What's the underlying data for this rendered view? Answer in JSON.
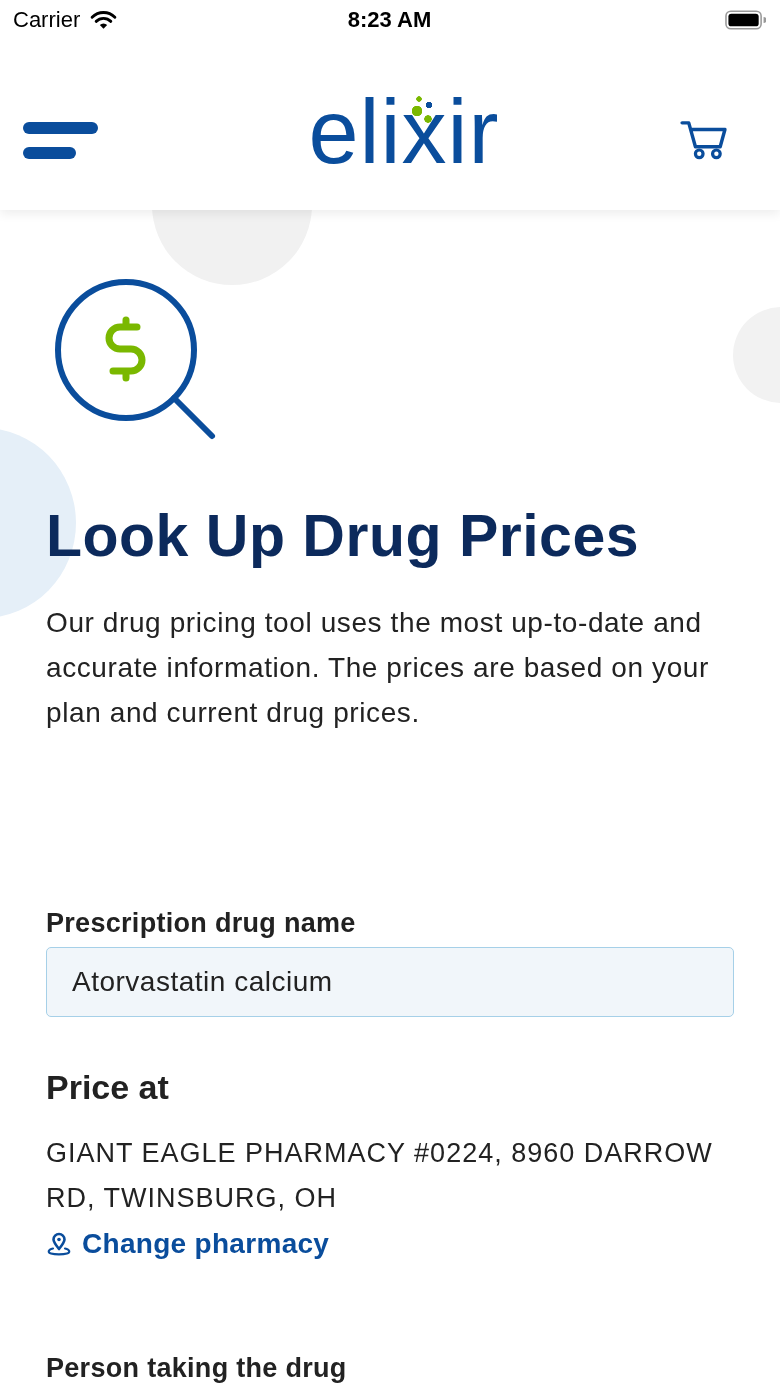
{
  "status_bar": {
    "carrier": "Carrier",
    "time": "8:23 AM"
  },
  "header": {
    "logo": "elixir"
  },
  "intro": {
    "title": "Look Up Drug Prices",
    "text": "Our drug pricing tool uses the most up-to-date and accurate information. The prices are based on your plan and current drug prices."
  },
  "drug_field": {
    "label": "Prescription drug name",
    "value": "Atorvastatin calcium"
  },
  "pharmacy": {
    "heading": "Price at",
    "address": "GIANT EAGLE PHARMACY #0224, 8960 DARROW RD, TWINSBURG, OH",
    "link": "Change pharmacy"
  },
  "person_field": {
    "label": "Person taking the drug"
  }
}
